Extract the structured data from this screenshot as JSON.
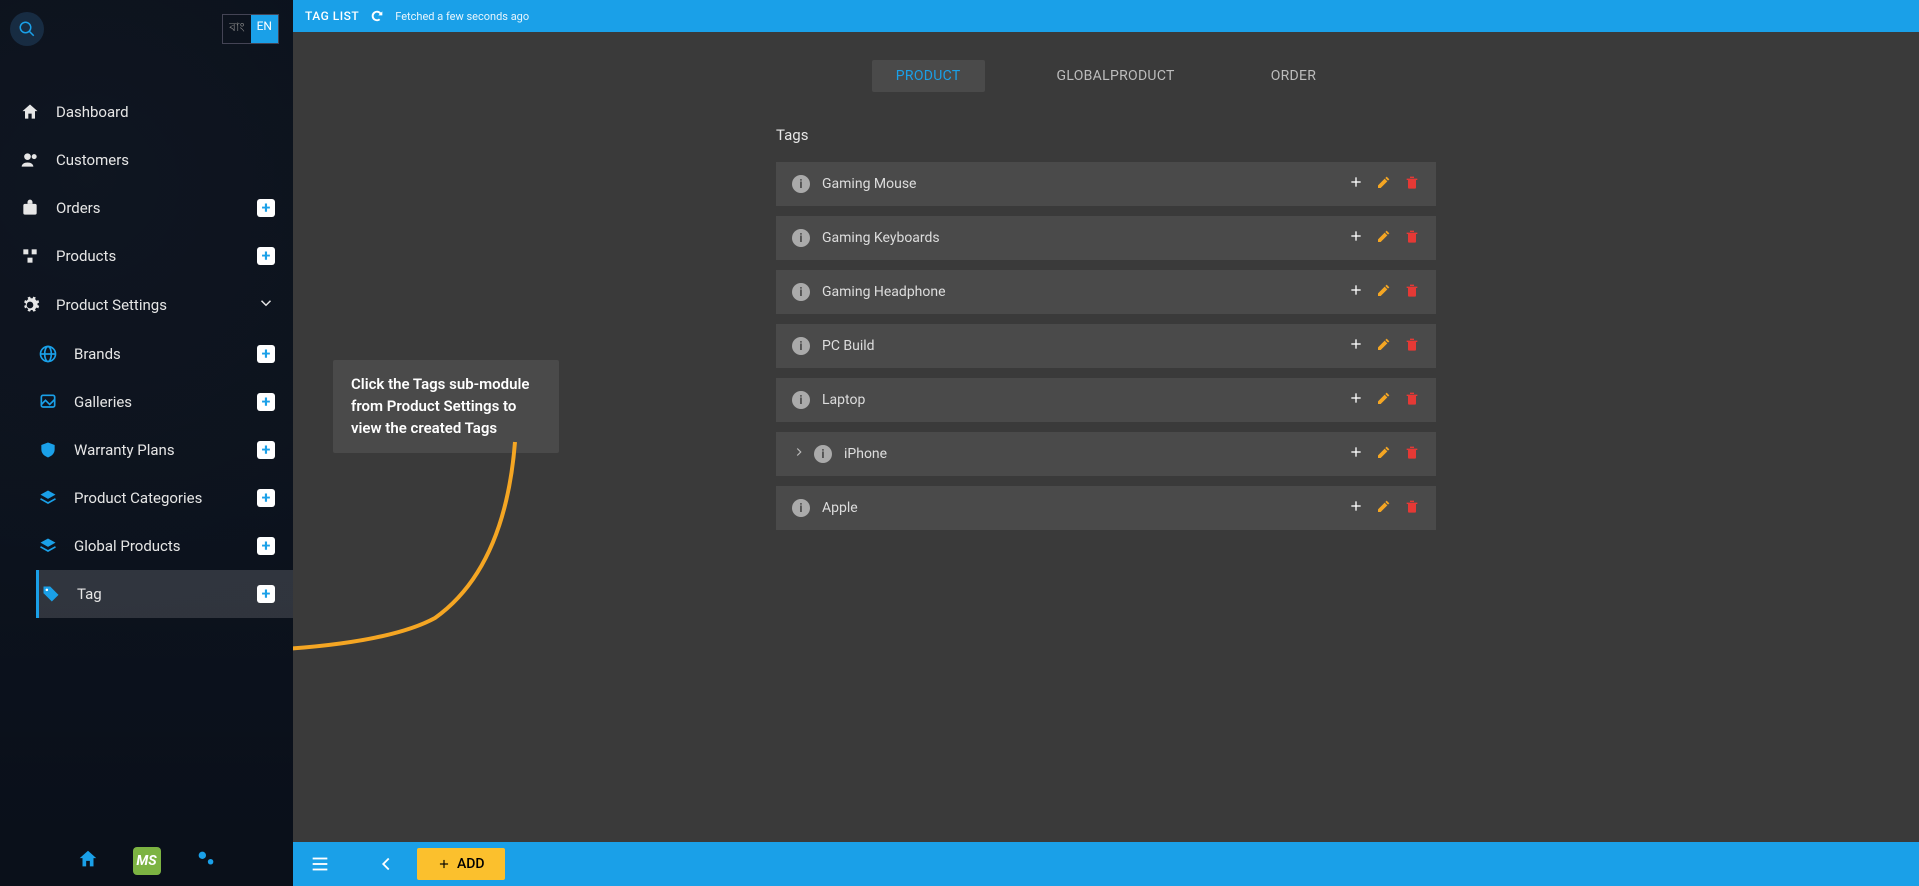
{
  "lang": {
    "inactive": "বাং",
    "active": "EN"
  },
  "sidebar": {
    "items": [
      {
        "label": "Dashboard"
      },
      {
        "label": "Customers"
      },
      {
        "label": "Orders"
      },
      {
        "label": "Products"
      },
      {
        "label": "Product Settings"
      }
    ],
    "sub": [
      {
        "label": "Brands"
      },
      {
        "label": "Galleries"
      },
      {
        "label": "Warranty Plans"
      },
      {
        "label": "Product Categories"
      },
      {
        "label": "Global Products"
      },
      {
        "label": "Tag"
      }
    ],
    "ms": "MS"
  },
  "topbar": {
    "title": "TAG LIST",
    "fetch": "Fetched a few seconds ago"
  },
  "tabs": {
    "product": "PRODUCT",
    "global": "GLOBALPRODUCT",
    "order": "ORDER"
  },
  "section": {
    "heading": "Tags",
    "rows": [
      {
        "label": "Gaming Mouse"
      },
      {
        "label": "Gaming Keyboards"
      },
      {
        "label": "Gaming Headphone"
      },
      {
        "label": "PC Build"
      },
      {
        "label": "Laptop"
      },
      {
        "label": "iPhone",
        "expandable": true
      },
      {
        "label": "Apple"
      }
    ]
  },
  "tooltip": "Click the Tags sub-module from Product Settings to view the created Tags",
  "bottom": {
    "add": "ADD"
  }
}
